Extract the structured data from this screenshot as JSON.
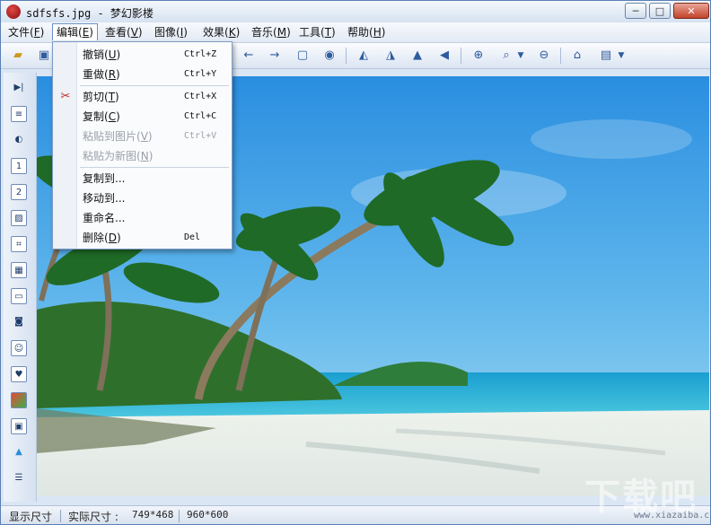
{
  "window": {
    "title": "sdfsfs.jpg - 梦幻影楼",
    "minimize": "─",
    "maximize": "□",
    "close": "✕"
  },
  "menubar": {
    "items": [
      {
        "label": "文件",
        "key": "F"
      },
      {
        "label": "编辑",
        "key": "E"
      },
      {
        "label": "查看",
        "key": "V"
      },
      {
        "label": "图像",
        "key": "I"
      },
      {
        "label": "效果",
        "key": "K"
      },
      {
        "label": "音乐",
        "key": "M"
      },
      {
        "label": "工具",
        "key": "T"
      },
      {
        "label": "帮助",
        "key": "H"
      }
    ]
  },
  "edit_menu": {
    "items": [
      {
        "label": "撤销",
        "key": "U",
        "shortcut": "Ctrl+Z",
        "disabled": false
      },
      {
        "label": "重做",
        "key": "R",
        "shortcut": "Ctrl+Y",
        "disabled": false
      },
      {
        "label": "剪切",
        "key": "T",
        "shortcut": "Ctrl+X",
        "disabled": false
      },
      {
        "label": "复制",
        "key": "C",
        "shortcut": "Ctrl+C",
        "disabled": false
      },
      {
        "label": "粘贴到图片",
        "key": "V",
        "shortcut": "Ctrl+V",
        "disabled": true
      },
      {
        "label": "粘贴为新图",
        "key": "N",
        "shortcut": "",
        "disabled": true
      },
      {
        "label": "复制到...",
        "key": "",
        "shortcut": "",
        "disabled": false
      },
      {
        "label": "移动到...",
        "key": "",
        "shortcut": "",
        "disabled": false
      },
      {
        "label": "重命名...",
        "key": "",
        "shortcut": "",
        "disabled": false
      },
      {
        "label": "删除",
        "key": "D",
        "shortcut": "Del",
        "disabled": false
      }
    ]
  },
  "toolbar": {
    "icons": [
      "open-folder-icon",
      "save-icon",
      "arrow-left-icon",
      "arrow-right-icon",
      "fit-window-icon",
      "actual-size-icon",
      "rotate-left-icon",
      "rotate-right-icon",
      "flip-horizontal-icon",
      "flip-vertical-icon",
      "zoom-in-icon",
      "zoom-dropdown-icon",
      "zoom-out-icon",
      "home-icon",
      "wallpaper-icon"
    ]
  },
  "sidebar": {
    "icons": [
      "slideshow-icon",
      "adjust-icon",
      "contrast-icon",
      "page-one-icon",
      "page-two-icon",
      "landscape-icon",
      "crop-icon",
      "frame-icon",
      "border-icon",
      "camera-icon",
      "portrait-icon",
      "heart-frame-icon",
      "color-icon",
      "gallery-icon",
      "triangle-icon",
      "list-icon"
    ]
  },
  "statusbar": {
    "display_size": "显示尺寸",
    "actual_size_label": "实际尺寸 :",
    "displayed_dims": "749*468",
    "actual_dims": "960*600"
  },
  "watermark": {
    "text": "下载吧",
    "url": "www.xiazaiba.com"
  },
  "colors": {
    "title_gradient_top": "#f4f8fd",
    "accent_blue": "#2e5c9e",
    "scissors_red": "#c0262a"
  }
}
